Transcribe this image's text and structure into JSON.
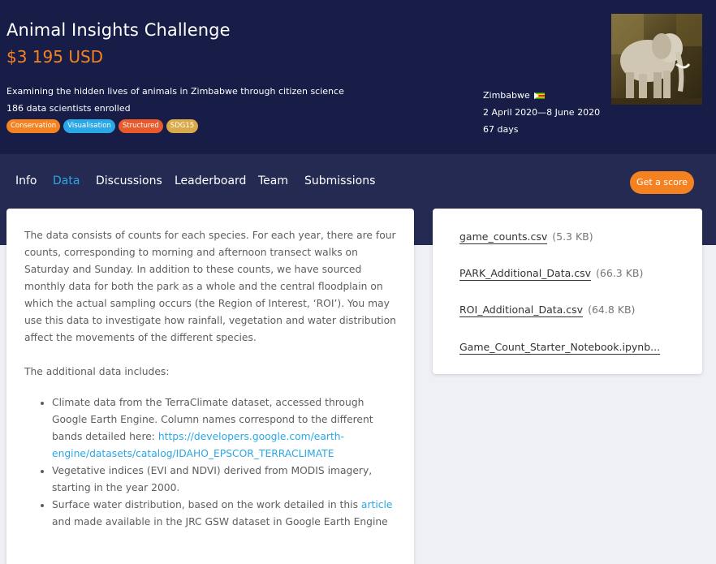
{
  "hero": {
    "title": "Animal Insights Challenge",
    "prize": "$3 195 USD",
    "subtitle": "Examining the hidden lives of animals in Zimbabwe through citizen science",
    "enrolled": "186 data scientists enrolled",
    "tags": [
      {
        "label": "Conservation",
        "color": "#f58220"
      },
      {
        "label": "Visualisation",
        "color": "#2aa7e6"
      },
      {
        "label": "Structured",
        "color": "#e85a2c"
      },
      {
        "label": "SDG15",
        "color": "#d9a94a"
      }
    ],
    "country": "Zimbabwe",
    "dates": "2 April 2020—8 June 2020",
    "duration": "67 days",
    "image_icon": "elephant-photo"
  },
  "nav": {
    "tabs": [
      "Info",
      "Data",
      "Discussions",
      "Leaderboard",
      "Team",
      "Submissions"
    ],
    "active_tab": "Data",
    "score_button": "Get a score"
  },
  "content": {
    "para1": "The data consists of counts for each species. For each year, there are four counts, corresponding to morning and afternoon transect walks on Saturday and Sunday. In addition to these counts, we have sourced monthly data for both the park as a whole and the central floodplain on which the actual sampling occurs (the Region of Interest, ‘ROI’). You may use this data to investigate how rainfall, vegetation and water distribution affect the movements of the different species.",
    "para2": "The additional data includes:",
    "bullet1_text": "Climate data from the TerraClimate dataset, accessed through Google Earth Engine. Column names correspond to the different bands detailed here: ",
    "bullet1_link": "https://developers.google.com/earth-engine/datasets/catalog/IDAHO_EPSCOR_TERRACLIMATE",
    "bullet2_text": "Vegetative indices (EVI and NDVI) derived from MODIS imagery, starting in the year 2000.",
    "bullet3_pre": "Surface water distribution, based on the work detailed in this ",
    "bullet3_link": "article",
    "bullet3_post": " and made available in the JRC GSW dataset in Google Earth Engine"
  },
  "files": [
    {
      "name": "game_counts.csv",
      "size": "(5.3 KB)"
    },
    {
      "name": "PARK_Additional_Data.csv",
      "size": "(66.3 KB)"
    },
    {
      "name": "ROI_Additional_Data.csv",
      "size": "(64.8 KB)"
    },
    {
      "name": "Game_Count_Starter_Notebook.ipynb...",
      "size": ""
    }
  ],
  "colors": {
    "hero_bg": "#181d47",
    "nav_bg": "#242a52",
    "accent_orange": "#f58220",
    "link_blue": "#2aa7e6"
  }
}
